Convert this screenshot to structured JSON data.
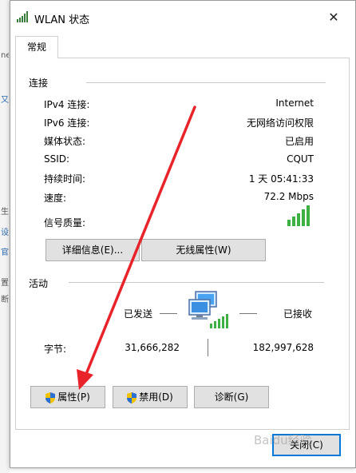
{
  "window": {
    "title": "WLAN 状态",
    "tab_general": "常规"
  },
  "connection": {
    "section_label": "连接",
    "rows": [
      {
        "label": "IPv4 连接:",
        "value": "Internet"
      },
      {
        "label": "IPv6 连接:",
        "value": "无网络访问权限"
      },
      {
        "label": "媒体状态:",
        "value": "已启用"
      },
      {
        "label": "SSID:",
        "value": "CQUT"
      },
      {
        "label": "持续时间:",
        "value": "1 天 05:41:33"
      },
      {
        "label": "速度:",
        "value": "72.2 Mbps"
      }
    ],
    "signal_label": "信号质量:",
    "signal_bars": 5,
    "details_button": "详细信息(E)...",
    "wireless_props_button": "无线属性(W)"
  },
  "activity": {
    "section_label": "活动",
    "sent_label": "已发送",
    "received_label": "已接收",
    "bytes_label": "字节:",
    "bytes_sent": "31,666,282",
    "bytes_received": "182,997,628"
  },
  "buttons": {
    "properties": "属性(P)",
    "disable": "禁用(D)",
    "diagnose": "诊断(G)",
    "close": "关闭(C)"
  },
  "background": {
    "left_marks": [
      "ne",
      "又",
      "生",
      "设",
      "官",
      "置",
      "断"
    ]
  },
  "watermark": "Baidu经验",
  "colors": {
    "signal_green": "#3cb043",
    "arrow_red": "#e8232a",
    "focus_blue": "#0078d7",
    "button_face": "#e1e1e1"
  },
  "icons": [
    "wlan-signal-icon",
    "close-icon",
    "network-computers-icon",
    "shield-icon",
    "red-arrow-annotation"
  ]
}
